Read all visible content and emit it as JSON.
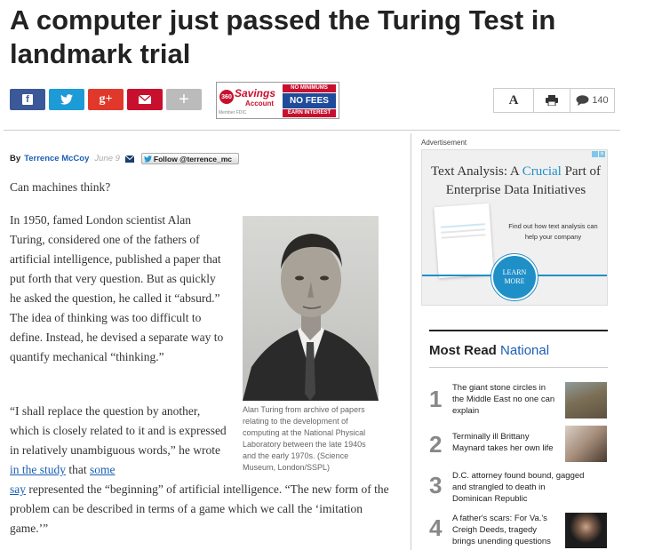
{
  "article": {
    "headline": "A computer just passed the Turing Test in landmark trial",
    "byline_prefix": "By",
    "author": "Terrence McCoy",
    "date": "June 9",
    "follow_label": "Follow @terrence_mc",
    "p1": "Can machines think?",
    "p2": "In 1950, famed London scientist Alan Turing, considered one of the fathers of artificial intelligence, published a paper that put forth that very question. But as quickly he asked the question, he called it “absurd.” The idea of thinking was too difficult to define. Instead, he devised a separate way to quantify mechanical “thinking.”",
    "p3_start": "“I shall replace the question by another, which is closely related to it and is expressed in relatively unambiguous words,” he wrote ",
    "p3_link1": "in the study",
    "p3_mid": " that ",
    "p3_link2": "some say",
    "p3_end": " represented the “beginning” of artificial intelligence. “The new form of the problem can be described in terms of a game which we call the ‘imitation game.’”",
    "caption": "Alan Turing from archive of papers relating to the development of computing at the National Physical Laboratory between the late 1940s and the early 1970s. (Science Museum, London/SSPL)"
  },
  "share": {
    "facebook_icon": "f",
    "twitter_icon": "✔",
    "gplus_icon": "g+",
    "email_icon": "✉",
    "more_icon": "+"
  },
  "banner_ad": {
    "brand_badge": "360",
    "savings_word": "Savings",
    "account_word": "Account",
    "member": "Member FDIC",
    "no_minimums": "NO MINIMUMS",
    "no_fees": "NO FEES",
    "earn_interest": "EARN INTEREST"
  },
  "tools": {
    "font_icon": "A",
    "comment_count": "140"
  },
  "sidebar_ad": {
    "label": "Advertisement",
    "title_pre": "Text Analysis: A ",
    "title_em": "Crucial",
    "title_post": " Part of Enterprise Data Initiatives",
    "find_out": "Find out how text analysis can help your company",
    "learn": "LEARN",
    "more": "MORE"
  },
  "most_read": {
    "heading": "Most Read",
    "section": "National",
    "items": [
      {
        "num": "1",
        "text": "The giant stone circles in the Middle East no one can explain"
      },
      {
        "num": "2",
        "text": "Terminally ill Brittany Maynard takes her own life"
      },
      {
        "num": "3",
        "text": "D.C. attorney found bound, gagged and strangled to death in Dominican Republic"
      },
      {
        "num": "4",
        "text": "A father's scars: For Va.'s Creigh Deeds, tragedy brings unending questions"
      }
    ]
  },
  "colors": {
    "facebook": "#3b5998",
    "twitter": "#1d9bd7",
    "gplus": "#e0392b",
    "email": "#c8102e",
    "more": "#bbbbbb",
    "link": "#1a5fb4",
    "ad_accent": "#1f8fc8"
  }
}
